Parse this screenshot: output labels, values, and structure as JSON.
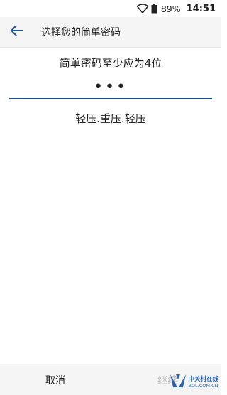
{
  "status_bar": {
    "wifi_icon": "wifi-icon",
    "battery_icon": "battery-icon",
    "battery_level": "89%",
    "time": "14:51"
  },
  "app_bar": {
    "back_icon": "arrow-back-icon",
    "title": "选择您的简单密码"
  },
  "main": {
    "instruction": "简单密码至少应为4位",
    "pin_value": "•••",
    "hint": "轻压.重压.轻压"
  },
  "bottom_bar": {
    "cancel_label": "取消",
    "continue_label": "继续"
  },
  "watermark": {
    "name_cn": "中关村在线",
    "domain": "ZOL.COM.CN"
  },
  "colors": {
    "accent": "#1e4e96",
    "bar_background": "#f5f5f5",
    "disabled_text": "#bdbdbd"
  }
}
